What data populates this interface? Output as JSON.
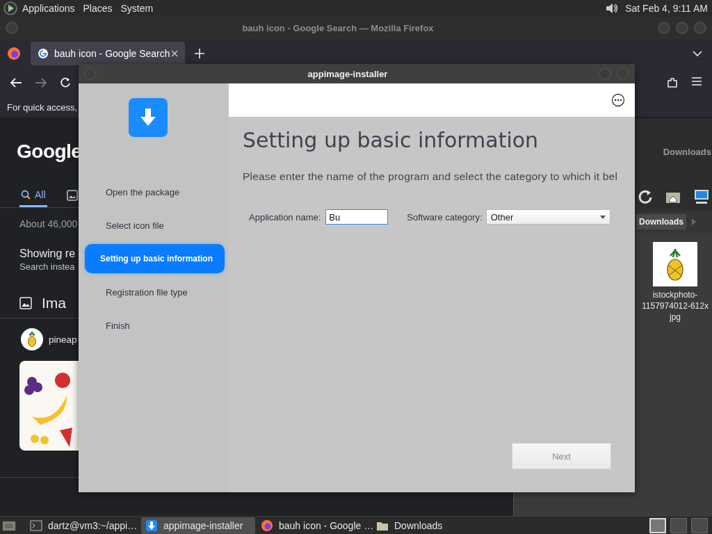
{
  "top_panel": {
    "menus": [
      "Applications",
      "Places",
      "System"
    ],
    "clock": "Sat Feb 4, 9:11 AM"
  },
  "browser": {
    "title": "bauh icon - Google Search — Mozilla Firefox",
    "tabs": [
      {
        "label": "bauh icon - Google Search",
        "selected": true
      }
    ],
    "bookmarks_hint": "For quick access,",
    "page": {
      "logo": "Google",
      "nav_tabs": [
        {
          "label": "All",
          "selected": true
        }
      ],
      "result_stats": "About 46,000",
      "showing": "Showing re",
      "search_instead": "Search instea",
      "images_heading": "Ima",
      "chips": [
        {
          "label": "pineap"
        }
      ]
    }
  },
  "file_manager": {
    "title": "Downloads",
    "breadcrumb": "Downloads",
    "files": [
      {
        "label_lines": [
          "istockphoto-",
          "1157974012-612x",
          "jpg"
        ]
      }
    ]
  },
  "installer": {
    "title": "appimage-installer",
    "steps": [
      {
        "label": "Open the package",
        "selected": false
      },
      {
        "label": "Select icon file",
        "selected": false
      },
      {
        "label": "Setting up basic information",
        "selected": true
      },
      {
        "label": "Registration file type",
        "selected": false
      },
      {
        "label": "Finish",
        "selected": false
      }
    ],
    "heading": "Setting up basic information",
    "instructions": "Please enter the name of the program and select the category to which it bel",
    "fields": [
      {
        "kind": "text",
        "label": "Application name:",
        "value": "Bu"
      },
      {
        "kind": "select",
        "label": "Software category:",
        "value": "Other"
      }
    ],
    "next_button": {
      "label": "Next",
      "disabled": true
    }
  },
  "taskbar": {
    "items": [
      {
        "kind": "terminal",
        "label": "dartz@vm3:~/appi…",
        "selected": false
      },
      {
        "kind": "installer",
        "label": "appimage-installer",
        "selected": true
      },
      {
        "kind": "browser",
        "label": "bauh icon - Google …",
        "selected": false
      },
      {
        "kind": "folder",
        "label": "Downloads",
        "selected": false
      }
    ],
    "workspaces": [
      {
        "selected": true
      },
      {
        "selected": false
      },
      {
        "selected": false
      }
    ]
  }
}
